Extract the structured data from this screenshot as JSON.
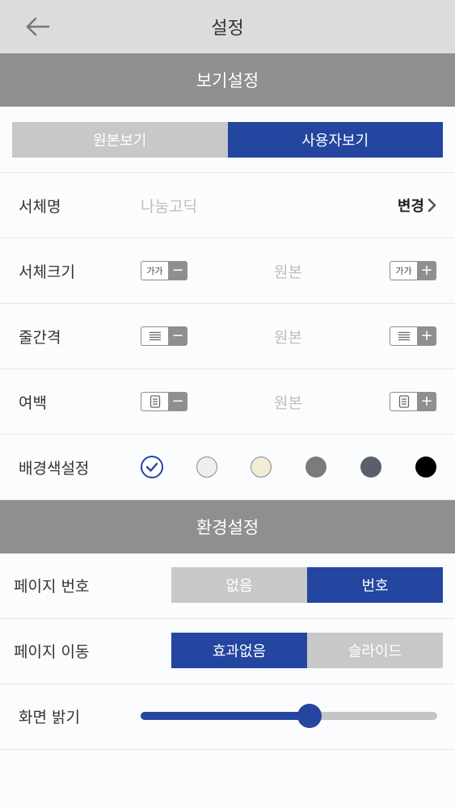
{
  "header": {
    "title": "설정",
    "back_icon": "arrow-left-icon"
  },
  "view_settings": {
    "section_title": "보기설정",
    "view_mode": {
      "options": [
        "원본보기",
        "사용자보기"
      ],
      "selected": "사용자보기"
    },
    "font_name": {
      "label": "서체명",
      "value": "나눔고딕",
      "change_label": "변경"
    },
    "font_size": {
      "label": "서체크기",
      "value": "원본",
      "icon_text": "가가"
    },
    "line_spacing": {
      "label": "줄간격",
      "value": "원본"
    },
    "margin": {
      "label": "여백",
      "value": "원본"
    },
    "background": {
      "label": "배경색설정",
      "colors": [
        "#ffffff",
        "#efefef",
        "#f1ecd6",
        "#7b7b7b",
        "#5a5f69",
        "#000000"
      ],
      "selected_index": 0
    }
  },
  "env_settings": {
    "section_title": "환경설정",
    "page_number": {
      "label": "페이지 번호",
      "options": [
        "없음",
        "번호"
      ],
      "selected": "번호"
    },
    "page_move": {
      "label": "페이지 이동",
      "options": [
        "효과없음",
        "슬라이드"
      ],
      "selected": "효과없음"
    },
    "brightness": {
      "label": "화면 밝기",
      "value": 0.57
    }
  },
  "colors": {
    "accent": "#2446a1",
    "inactive": "#c8c8c8",
    "section": "#8f8f8f"
  }
}
